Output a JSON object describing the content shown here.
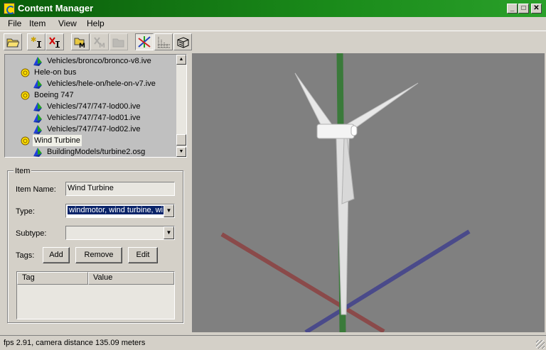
{
  "window": {
    "title": "Content Manager",
    "controls": [
      "_",
      "□",
      "✕"
    ]
  },
  "menu": {
    "file": "File",
    "item": "Item",
    "view": "View",
    "help": "Help"
  },
  "toolbar": {
    "buttons": [
      "open-folder-icon",
      "new-item-icon",
      "delete-item-icon",
      "add-model-icon",
      "remove-model-icon",
      "folder-disabled-icon",
      "axes-icon",
      "grid-icon",
      "box-icon"
    ]
  },
  "tree": {
    "rows": [
      {
        "kind": "model",
        "label": "Vehicles/bronco/bronco-v8.ive"
      },
      {
        "kind": "item",
        "label": "Hele-on bus"
      },
      {
        "kind": "model",
        "label": "Vehicles/hele-on/hele-on-v7.ive"
      },
      {
        "kind": "item",
        "label": "Boeing 747"
      },
      {
        "kind": "model",
        "label": "Vehicles/747/747-lod00.ive"
      },
      {
        "kind": "model",
        "label": "Vehicles/747/747-lod01.ive"
      },
      {
        "kind": "model",
        "label": "Vehicles/747/747-lod02.ive"
      },
      {
        "kind": "item",
        "label": "Wind Turbine",
        "selected": true
      },
      {
        "kind": "model",
        "label": "BuildingModels/turbine2.osg"
      }
    ]
  },
  "item_panel": {
    "group_title": "Item",
    "name_label": "Item Name:",
    "name_value": "Wind Turbine",
    "type_label": "Type:",
    "type_value": "windmotor, wind turbine, wi",
    "subtype_label": "Subtype:",
    "subtype_value": "",
    "tags_label": "Tags:",
    "add_label": "Add",
    "remove_label": "Remove",
    "edit_label": "Edit",
    "col_tag": "Tag",
    "col_value": "Value"
  },
  "colors": {
    "title_bar": "#1a8a1a",
    "viewport_bg": "#808080",
    "selection": "#0a246a"
  },
  "status": {
    "text": "fps 2.91, camera distance 135.09 meters"
  }
}
